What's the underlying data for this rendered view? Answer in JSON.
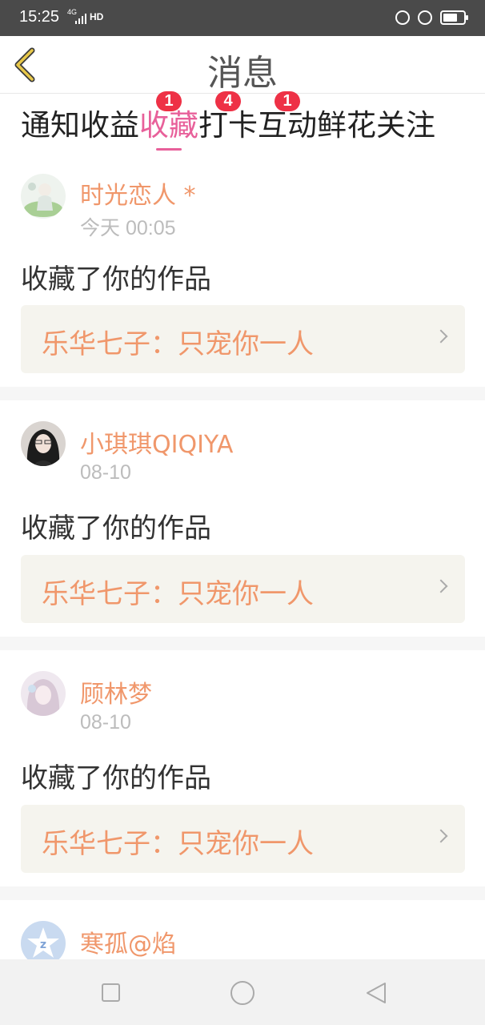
{
  "status_bar": {
    "time": "15:25",
    "network": "4G",
    "hd": "HD"
  },
  "header": {
    "title": "消息"
  },
  "tabs": [
    {
      "label": "通知",
      "badge": ""
    },
    {
      "label": "收益",
      "badge": ""
    },
    {
      "label": "收藏",
      "badge": "1",
      "active": true
    },
    {
      "label": "打卡",
      "badge": "4"
    },
    {
      "label": "互动",
      "badge": "1"
    },
    {
      "label": "鲜花",
      "badge": ""
    },
    {
      "label": "关注",
      "badge": ""
    }
  ],
  "notifications": [
    {
      "username": "时光恋人 *",
      "time": "今天 00:05",
      "action": "收藏了你的作品",
      "work_title": "乐华七子：只宠你一人"
    },
    {
      "username": "小琪琪QIQIYA",
      "time": "08-10",
      "action": "收藏了你的作品",
      "work_title": "乐华七子：只宠你一人"
    },
    {
      "username": "顾林梦",
      "time": "08-10",
      "action": "收藏了你的作品",
      "work_title": "乐华七子：只宠你一人"
    },
    {
      "username": "寒孤@焰"
    }
  ],
  "colors": {
    "accent_pink": "#e8609a",
    "username_orange": "#f0976b",
    "badge_red": "#ee3146"
  },
  "icons": {
    "back": "chevron-left-icon",
    "nav_recent": "square-icon",
    "nav_home": "circle-icon",
    "nav_back": "triangle-back-icon"
  }
}
